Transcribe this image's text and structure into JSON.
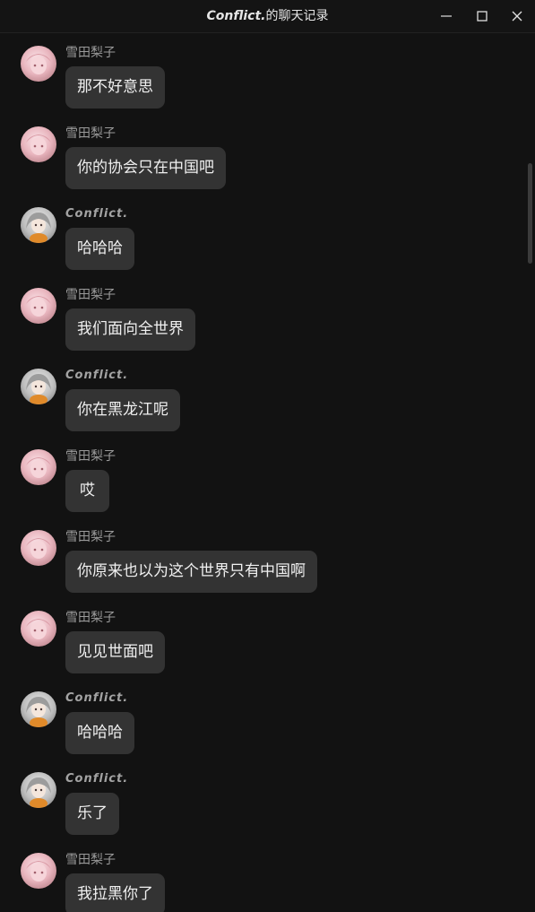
{
  "window": {
    "title_name": "Conflict.",
    "title_suffix": "的聊天记录"
  },
  "colors": {
    "background": "#121212",
    "bubble": "#333333",
    "sender_name": "#9a9a9a",
    "message_text": "#f0f0f0"
  },
  "messages": [
    {
      "sender": "雪田梨子",
      "text": "那不好意思",
      "avatar": "pink-avatar-icon"
    },
    {
      "sender": "雪田梨子",
      "text": "你的协会只在中国吧",
      "avatar": "pink-avatar-icon"
    },
    {
      "sender": "Conflict.",
      "text": "哈哈哈",
      "avatar": "gray-hair-avatar-icon"
    },
    {
      "sender": "雪田梨子",
      "text": "我们面向全世界",
      "avatar": "pink-avatar-icon"
    },
    {
      "sender": "Conflict.",
      "text": "你在黑龙江呢",
      "avatar": "gray-hair-avatar-icon"
    },
    {
      "sender": "雪田梨子",
      "text": "哎",
      "avatar": "pink-avatar-icon"
    },
    {
      "sender": "雪田梨子",
      "text": "你原来也以为这个世界只有中国啊",
      "avatar": "pink-avatar-icon"
    },
    {
      "sender": "雪田梨子",
      "text": "见见世面吧",
      "avatar": "pink-avatar-icon"
    },
    {
      "sender": "Conflict.",
      "text": "哈哈哈",
      "avatar": "gray-hair-avatar-icon"
    },
    {
      "sender": "Conflict.",
      "text": "乐了",
      "avatar": "gray-hair-avatar-icon"
    },
    {
      "sender": "雪田梨子",
      "text": "我拉黑你了",
      "avatar": "pink-avatar-icon"
    }
  ]
}
